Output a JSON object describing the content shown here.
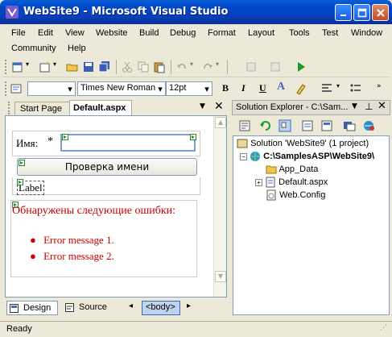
{
  "window": {
    "title": "WebSite9 - Microsoft Visual Studio"
  },
  "menu": {
    "row1": [
      "File",
      "Edit",
      "View",
      "Website",
      "Build",
      "Debug",
      "Format",
      "Layout",
      "Tools",
      "Test",
      "Window"
    ],
    "row2": [
      "Community",
      "Help"
    ]
  },
  "format_toolbar": {
    "style_value": "",
    "font_name": "Times New Roman",
    "font_size": "12pt",
    "bold": "B",
    "italic": "I",
    "underline": "U",
    "font_color": "A"
  },
  "doc_tabs": {
    "start_page": "Start Page",
    "active": "Default.aspx"
  },
  "designer": {
    "name_label": "Имя:",
    "required_marker": "*",
    "check_button": "Проверка имени",
    "label_text": "Label",
    "summary_header": "Обнаружены следующие ошибки:",
    "errors": [
      "Error message 1.",
      "Error message 2."
    ]
  },
  "bottom_bar": {
    "design": "Design",
    "source": "Source",
    "tag": "<body>"
  },
  "solution_explorer": {
    "title": "Solution Explorer - C:\\Sam...",
    "solution": "Solution 'WebSite9' (1 project)",
    "project": "C:\\SamplesASP\\WebSite9\\",
    "items": [
      "App_Data",
      "Default.aspx",
      "Web.Config"
    ]
  },
  "status": {
    "text": "Ready"
  },
  "colors": {
    "titlebar": "#0a47c8",
    "error_red": "#cc0000",
    "chrome": "#ece9d8"
  }
}
